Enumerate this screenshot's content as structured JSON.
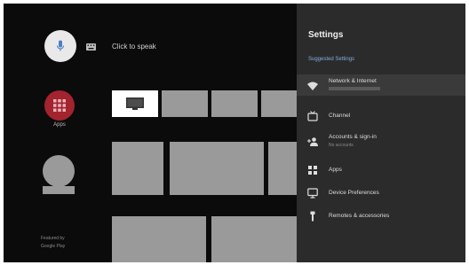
{
  "search": {
    "prompt": "Click to speak",
    "mic_icon": "mic-icon",
    "keyboard_icon": "keyboard-icon"
  },
  "apps": {
    "label": "Apps",
    "icon": "apps-grid-icon"
  },
  "footer": {
    "featured": "Featured by",
    "source": "Google Play"
  },
  "settings": {
    "title": "Settings",
    "section": "Suggested Settings",
    "items": [
      {
        "label": "Network & Internet",
        "sub": "",
        "icon": "wifi-icon"
      },
      {
        "label": "Channel",
        "sub": "",
        "icon": "tv-icon"
      },
      {
        "label": "Accounts & sign-in",
        "sub": "No accounts",
        "icon": "person-add-icon"
      },
      {
        "label": "Apps",
        "sub": "",
        "icon": "apps-icon"
      },
      {
        "label": "Device Preferences",
        "sub": "",
        "icon": "monitor-icon"
      },
      {
        "label": "Remotes & accessories",
        "sub": "",
        "icon": "remote-icon"
      }
    ]
  },
  "colors": {
    "screen_bg": "#0b0b0b",
    "panel_bg": "#2b2b2b",
    "apps_red": "#a3232f",
    "accent_blue": "#7fb0e0",
    "placeholder_gray": "#9a9a9a"
  }
}
